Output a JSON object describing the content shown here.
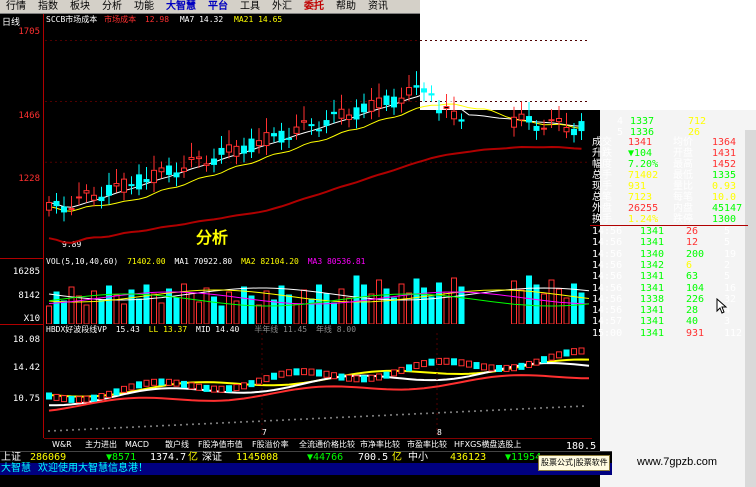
{
  "menu": [
    "行情",
    "指数",
    "板块",
    "分析",
    "功能",
    "大智慧",
    "平台",
    "工具",
    "外汇",
    "委托",
    "帮助",
    "资讯"
  ],
  "menu_highlight": {
    "大智慧": "blue",
    "平台": "blue",
    "委托": "red"
  },
  "kline": {
    "period_tag": "日线",
    "header": {
      "name": "SCCB市场成本",
      "label2": "市场成本",
      "v1": "12.98",
      "ma7": "MA7  14.32",
      "ma21": "MA21  14.65"
    },
    "axis": [
      "1705",
      "1466",
      "1228"
    ],
    "low_label": "9.89",
    "overlay_text": "分析"
  },
  "volume": {
    "header": {
      "name": "VOL(5,10,40,60)",
      "v": "71402.00",
      "ma1": "MA1  70922.80",
      "ma2": "MA2  82104.20",
      "ma3": "MA3  80536.81"
    },
    "axis": [
      "16285",
      "8142",
      "X10"
    ]
  },
  "indicator": {
    "header": {
      "name": "HBDX好波段线VP",
      "v": "15.43",
      "ll": "LL 13.37",
      "mid": "MID 14.40",
      "half": "半年线 11.45",
      "year": "年线  8.00"
    },
    "axis": [
      "18.08",
      "14.42",
      "10.75"
    ],
    "month_labels": [
      "7",
      "8"
    ]
  },
  "quote": {
    "book": [
      {
        "lvl": "4",
        "price": "1337",
        "vol": "712"
      },
      {
        "lvl": "5",
        "price": "1336",
        "vol": "26"
      }
    ],
    "stats": [
      {
        "l1": "成交",
        "v1": "1341",
        "l2": "均价",
        "v2": "1364"
      },
      {
        "l1": "升跌",
        "v1": "▼104",
        "l2": "开盘",
        "v2": "1431"
      },
      {
        "l1": "幅度",
        "v1": "7.20%",
        "l2": "最高",
        "v2": "1452"
      },
      {
        "l1": "总手",
        "v1": "71402",
        "l2": "最低",
        "v2": "1335"
      },
      {
        "l1": "现手",
        "v1": "931",
        "l2": "量比",
        "v2": "0.93"
      },
      {
        "l1": "总笔",
        "v1": "7123",
        "l2": "每笔",
        "v2": "10.0"
      },
      {
        "l1": "外盘",
        "v1": "26255",
        "l2": "内盘",
        "v2": "45147"
      },
      {
        "l1": "换手",
        "v1": "1.24%",
        "l2": "跌停",
        "v2": "1300"
      }
    ],
    "ticks": [
      {
        "time": "14:56",
        "price": "1341",
        "vol": "26",
        "num": "5"
      },
      {
        "time": "14:56",
        "price": "1341",
        "vol": "12",
        "num": "5"
      },
      {
        "time": "14:56",
        "price": "1340",
        "vol": "200",
        "num": "19"
      },
      {
        "time": "14:56",
        "price": "1342",
        "vol": "6",
        "num": "2"
      },
      {
        "time": "14:56",
        "price": "1341",
        "vol": "63",
        "num": "5"
      },
      {
        "time": "14:56",
        "price": "1341",
        "vol": "104",
        "num": "16"
      },
      {
        "time": "14:56",
        "price": "1338",
        "vol": "226",
        "num": "32"
      },
      {
        "time": "14:56",
        "price": "1341",
        "vol": "28",
        "num": "4"
      },
      {
        "time": "14:57",
        "price": "1341",
        "vol": "40",
        "num": "3"
      },
      {
        "time": "15:00",
        "price": "1341",
        "vol": "931",
        "num": "112"
      }
    ]
  },
  "tabs": [
    "W&R",
    "主力进出",
    "MACD",
    "散户线",
    "F股净值市值",
    "F股溢价率",
    "全流通价格比较",
    "市净率比较",
    "市盈率比较",
    "HFXGS横盘选股上"
  ],
  "status": {
    "sh_label": "上证",
    "sh_value": "286069",
    "sh_chg": "▼8571",
    "sh_amt": "1374.7",
    "unit1": "亿",
    "sz_label": "深证",
    "sz_value": "1145008",
    "sz_chg": "▼44766",
    "sz_amt": "700.5",
    "unit2": "亿",
    "mid_label": "中小",
    "mid_value": "436123",
    "mid_chg": "▼11954",
    "corner_value": "180.5"
  },
  "status2": {
    "brand": "大智慧",
    "message": "欢迎使用大智慧信息港！"
  },
  "ad_text": "股票公式|股票软件",
  "watermark": "www.7gpzb.com",
  "colors": {
    "up": "#ff3030",
    "down": "#00ffff",
    "yellow": "#ffff00",
    "green": "#00ff00",
    "white": "#ffffff"
  }
}
